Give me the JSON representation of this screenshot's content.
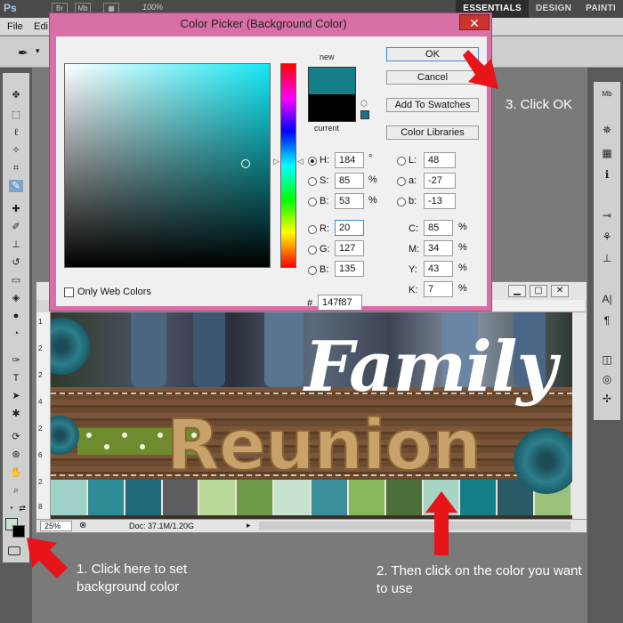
{
  "app": {
    "logo": "Ps",
    "topbar_buttons": [
      "Br",
      "Mb"
    ],
    "zoom": "100%",
    "workspaces": [
      "ESSENTIALS",
      "DESIGN",
      "PAINTI"
    ]
  },
  "menubar": {
    "items": [
      "File",
      "Edi"
    ]
  },
  "color_picker": {
    "title": "Color Picker (Background Color)",
    "close_label": "✕",
    "label_new": "new",
    "label_current": "current",
    "buttons": {
      "ok": "OK",
      "cancel": "Cancel",
      "add_to_swatches": "Add To Swatches",
      "color_libraries": "Color Libraries"
    },
    "fields": {
      "H": {
        "label": "H:",
        "value": "184",
        "unit": "°"
      },
      "S": {
        "label": "S:",
        "value": "85",
        "unit": "%"
      },
      "Bv": {
        "label": "B:",
        "value": "53",
        "unit": "%"
      },
      "R": {
        "label": "R:",
        "value": "20"
      },
      "G": {
        "label": "G:",
        "value": "127"
      },
      "Bc": {
        "label": "B:",
        "value": "135"
      },
      "L": {
        "label": "L:",
        "value": "48"
      },
      "a": {
        "label": "a:",
        "value": "-27"
      },
      "b": {
        "label": "b:",
        "value": "-13"
      },
      "C": {
        "label": "C:",
        "value": "85",
        "unit": "%"
      },
      "M": {
        "label": "M:",
        "value": "34",
        "unit": "%"
      },
      "Y": {
        "label": "Y:",
        "value": "43",
        "unit": "%"
      },
      "K": {
        "label": "K:",
        "value": "7",
        "unit": "%"
      }
    },
    "only_web_colors": "Only Web Colors",
    "hex_label": "#",
    "hex_value": "147f87",
    "new_color": "#147f87",
    "current_color": "#000000"
  },
  "document": {
    "zoom": "25%",
    "doc_size": "Doc: 37.1M/1.20G",
    "ruler_numbers": [
      "1",
      "2",
      "2",
      "4",
      "2",
      "6",
      "2",
      "8"
    ],
    "title_text": "Family",
    "subtitle_text": "Reunion"
  },
  "swatches": {
    "foreground": "#c6e3cd",
    "background": "#000000"
  },
  "annotations": {
    "step1": "1. Click here to set background color",
    "step2": "2. Then click on the color you want to use",
    "step3": "3. Click OK"
  },
  "colors": {
    "accent_arrow": "#e8141a",
    "dialog_frame": "#d86fa6"
  }
}
